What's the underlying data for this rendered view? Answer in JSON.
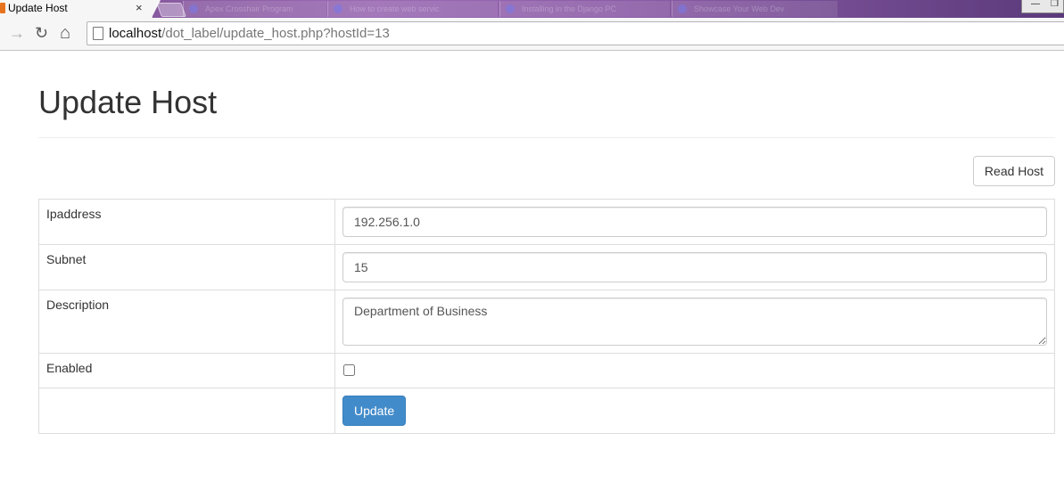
{
  "browser": {
    "active_tab": {
      "title": "Update Host",
      "close": "×"
    },
    "background_tabs": [
      "Apex Crosshair Program",
      "How to create web servic",
      "Installing in the Django PC",
      "Showcase Your Web Dev"
    ],
    "window_controls": {
      "minimize": "—",
      "restore": "❐"
    },
    "nav": {
      "back": "→",
      "reload": "↻",
      "home": "⌂"
    },
    "url": {
      "host": "localhost",
      "path": "/dot_label/update_host.php?hostId=13"
    }
  },
  "page": {
    "title": "Update Host",
    "read_button": "Read Host",
    "form": {
      "ipaddress_label": "Ipaddress",
      "ipaddress_value": "192.256.1.0",
      "subnet_label": "Subnet",
      "subnet_value": "15",
      "description_label": "Description",
      "description_value": "Department of Business",
      "enabled_label": "Enabled",
      "enabled_checked": false,
      "submit_label": "Update"
    }
  },
  "colors": {
    "primary_button": "#428bca",
    "tabstrip": "#8b5ca6"
  }
}
